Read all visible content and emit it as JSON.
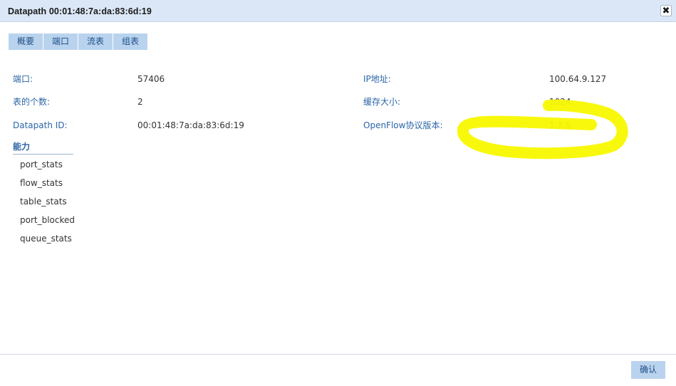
{
  "dialog": {
    "title": "Datapath 00:01:48:7a:da:83:6d:19",
    "close_symbol": "✖"
  },
  "tabs": [
    {
      "label": "概要"
    },
    {
      "label": "端口"
    },
    {
      "label": "流表"
    },
    {
      "label": "组表"
    }
  ],
  "details": {
    "port_label": "端口:",
    "port_value": "57406",
    "table_count_label": "表的个数:",
    "table_count_value": "2",
    "datapath_id_label": "Datapath ID:",
    "datapath_id_value": "00:01:48:7a:da:83:6d:19",
    "ip_label": "IP地址:",
    "ip_value": "100.64.9.127",
    "buffer_label": "缓存大小:",
    "buffer_value": "1024",
    "openflow_label": "OpenFlow协议版本:",
    "openflow_value": "1.3.0"
  },
  "capabilities": {
    "header": "能力",
    "items": [
      "port_stats",
      "flow_stats",
      "table_stats",
      "port_blocked",
      "queue_stats"
    ]
  },
  "footer": {
    "ok_label": "确认"
  },
  "annotation": {
    "color": "#f8f800"
  }
}
